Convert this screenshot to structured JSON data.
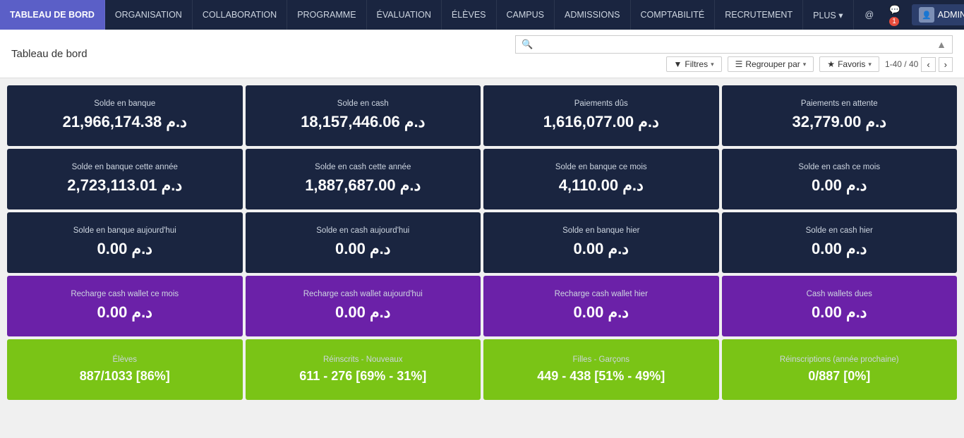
{
  "nav": {
    "items": [
      {
        "label": "TABLEAU DE BORD",
        "active": true
      },
      {
        "label": "ORGANISATION",
        "active": false
      },
      {
        "label": "COLLABORATION",
        "active": false
      },
      {
        "label": "PROGRAMME",
        "active": false
      },
      {
        "label": "ÉVALUATION",
        "active": false
      },
      {
        "label": "ÉLÈVES",
        "active": false
      },
      {
        "label": "CAMPUS",
        "active": false
      },
      {
        "label": "ADMISSIONS",
        "active": false
      },
      {
        "label": "COMPTABILITÉ",
        "active": false
      },
      {
        "label": "RECRUTEMENT",
        "active": false
      },
      {
        "label": "PLUS",
        "active": false
      }
    ],
    "at_icon": "@",
    "notif_count": "1",
    "admin_label": "ADMIN"
  },
  "toolbar": {
    "title": "Tableau de bord",
    "search_placeholder": "",
    "search_value": "",
    "filter_label": "Filtres",
    "group_label": "Regrouper par",
    "fav_label": "Favoris",
    "pagination": "1-40 / 40"
  },
  "cards": {
    "row1": [
      {
        "label": "Solde en banque",
        "value": "21,966,174.38 د.م",
        "color": "dark"
      },
      {
        "label": "Solde en cash",
        "value": "18,157,446.06 د.م",
        "color": "dark"
      },
      {
        "label": "Paiements dûs",
        "value": "1,616,077.00 د.م",
        "color": "dark"
      },
      {
        "label": "Paiements en attente",
        "value": "32,779.00 د.م",
        "color": "dark"
      }
    ],
    "row2": [
      {
        "label": "Solde en banque cette année",
        "value": "2,723,113.01 د.م",
        "color": "dark"
      },
      {
        "label": "Solde en cash cette année",
        "value": "1,887,687.00 د.م",
        "color": "dark"
      },
      {
        "label": "Solde en banque ce mois",
        "value": "4,110.00 د.م",
        "color": "dark"
      },
      {
        "label": "Solde en cash ce mois",
        "value": "0.00 د.م",
        "color": "dark"
      }
    ],
    "row3": [
      {
        "label": "Solde en banque aujourd'hui",
        "value": "0.00 د.م",
        "color": "dark"
      },
      {
        "label": "Solde en cash aujourd'hui",
        "value": "0.00 د.م",
        "color": "dark"
      },
      {
        "label": "Solde en banque hier",
        "value": "0.00 د.م",
        "color": "dark"
      },
      {
        "label": "Solde en cash hier",
        "value": "0.00 د.م",
        "color": "dark"
      }
    ],
    "row4": [
      {
        "label": "Recharge cash wallet ce mois",
        "value": "0.00 د.م",
        "color": "purple"
      },
      {
        "label": "Recharge cash wallet aujourd'hui",
        "value": "0.00 د.م",
        "color": "purple"
      },
      {
        "label": "Recharge cash wallet hier",
        "value": "0.00 د.م",
        "color": "purple"
      },
      {
        "label": "Cash wallets dues",
        "value": "0.00 د.م",
        "color": "purple"
      }
    ],
    "row5": [
      {
        "label": "Élèves",
        "value": "887/1033 [86%]",
        "color": "green"
      },
      {
        "label": "Réinscrits - Nouveaux",
        "value": "611 - 276 [69% - 31%]",
        "color": "green"
      },
      {
        "label": "Filles - Garçons",
        "value": "449 - 438 [51% - 49%]",
        "color": "green"
      },
      {
        "label": "Réinscriptions (année prochaine)",
        "value": "0/887 [0%]",
        "color": "green"
      }
    ]
  }
}
